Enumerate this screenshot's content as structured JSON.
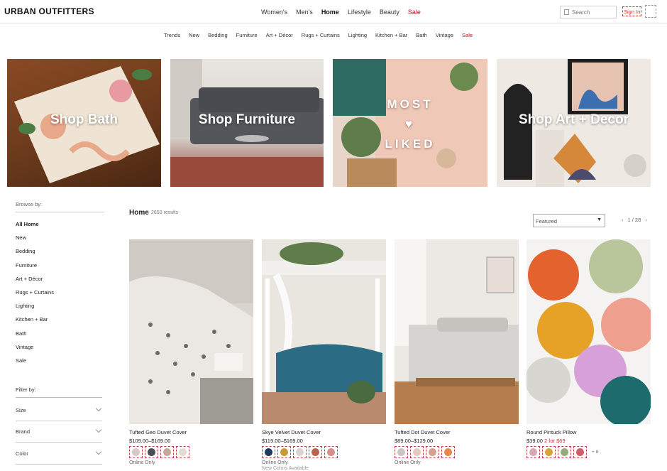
{
  "header": {
    "logo": "URBAN OUTFITTERS",
    "nav": [
      "Women's",
      "Men's",
      "Home",
      "Lifestyle",
      "Beauty",
      "Sale"
    ],
    "active_nav": "Home",
    "search_placeholder": "Search",
    "signin_label": "Sign In"
  },
  "subnav": [
    "Trends",
    "New",
    "Bedding",
    "Furniture",
    "Art + Décor",
    "Rugs + Curtains",
    "Lighting",
    "Kitchen + Bar",
    "Bath",
    "Vintage",
    "Sale"
  ],
  "hero": {
    "tiles": [
      {
        "label": "Shop Bath"
      },
      {
        "label": "Shop Furniture"
      },
      {
        "label": "MOST\n♥\nLIKED"
      },
      {
        "label": "Shop Art + Decor"
      }
    ]
  },
  "sidebar": {
    "browse_title": "Browse by:",
    "items": [
      "All Home",
      "New",
      "Bedding",
      "Furniture",
      "Art + Décor",
      "Rugs + Curtains",
      "Lighting",
      "Kitchen + Bar",
      "Bath",
      "Vintage",
      "Sale"
    ],
    "filter_title": "Filter by:",
    "filters": [
      "Size",
      "Brand",
      "Color"
    ]
  },
  "listing": {
    "title": "Home",
    "count": "2650 results",
    "sort_value": "Featured",
    "pager": "1 / 28"
  },
  "products": [
    {
      "name": "Tufted Geo Duvet Cover",
      "price": "$109.00–$169.00",
      "promo": "",
      "swatches": [
        "#d8c9c6",
        "#4a4e59",
        "#c9a79a",
        "#e4dcd3"
      ],
      "more": "",
      "note": "Online Only",
      "note2": ""
    },
    {
      "name": "Skye Velvet Duvet Cover",
      "price": "$119.00–$169.00",
      "promo": "",
      "swatches": [
        "#1f3a5c",
        "#c99a35",
        "#d8d4cf",
        "#b9634c",
        "#d68f8a"
      ],
      "more": "",
      "note": "Online Only",
      "note2": "New Colors Available"
    },
    {
      "name": "Tufted Dot Duvet Cover",
      "price": "$89.00–$129.00",
      "promo": "",
      "swatches": [
        "#c9c6c4",
        "#e8c9c0",
        "#d99e90",
        "#e5874e"
      ],
      "more": "",
      "note": "Online Only",
      "note2": ""
    },
    {
      "name": "Round Pintuck Pillow",
      "price": "$39.00",
      "promo": "2 for $69",
      "swatches": [
        "#d9a6b4",
        "#d7a43a",
        "#9aa77f",
        "#d45b6a"
      ],
      "more": "+ 8",
      "note": "",
      "note2": ""
    }
  ]
}
